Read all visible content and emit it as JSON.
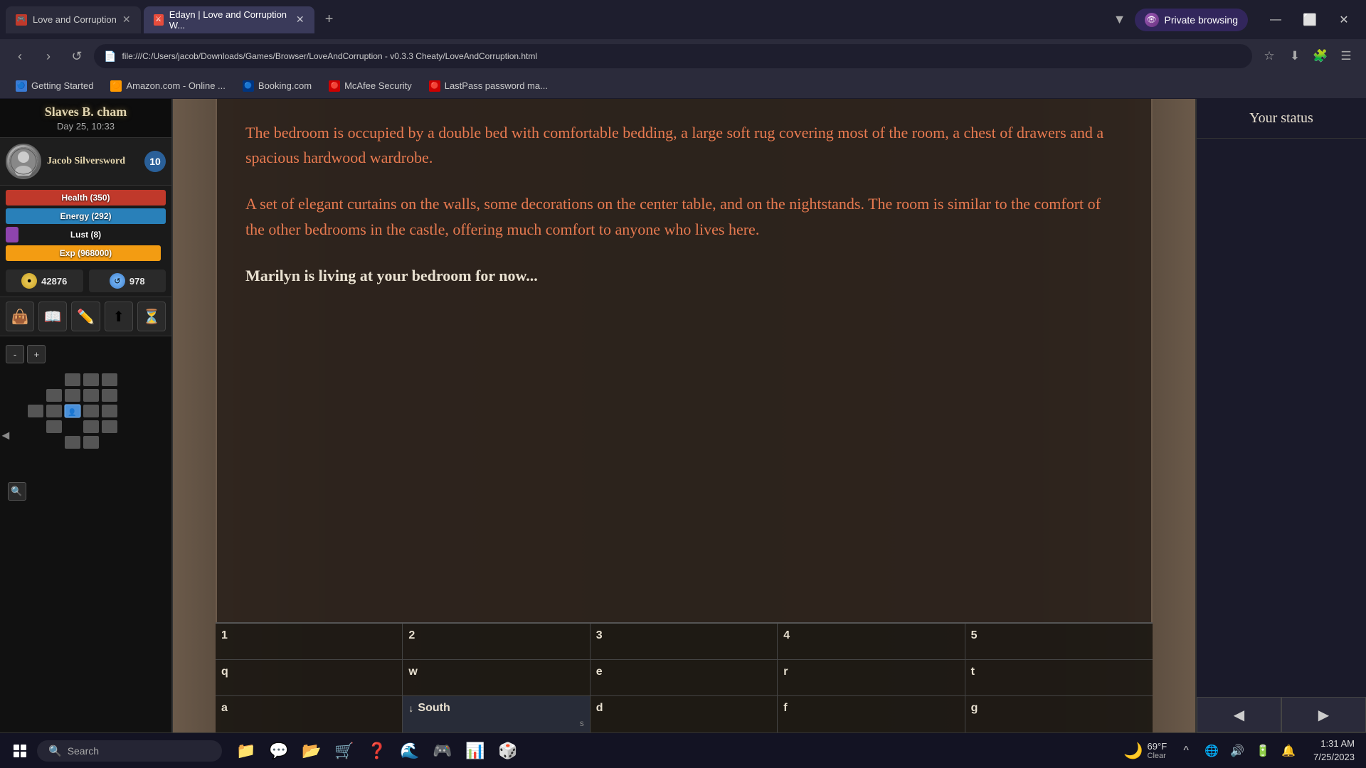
{
  "browser": {
    "tab1": {
      "label": "Love and Corruption",
      "favicon_color": "#c0392b"
    },
    "tab2": {
      "label": "Edayn | Love and Corruption W...",
      "favicon_color": "#e74c3c"
    },
    "address": "file:///C:/Users/jacob/Downloads/Games/Browser/LoveAndCorruption - v0.3.3 Cheaty/LoveAndCorruption.html",
    "bookmarks": [
      {
        "label": "Getting Started",
        "favicon": "🔵"
      },
      {
        "label": "Amazon.com - Online ...",
        "favicon": "🟠"
      },
      {
        "label": "Booking.com",
        "favicon": "🔵"
      },
      {
        "label": "McAfee Security",
        "favicon": "🔴"
      },
      {
        "label": "LastPass password ma...",
        "favicon": "🔴"
      }
    ],
    "private_label": "Private browsing"
  },
  "game": {
    "location": "Slaves B. cham",
    "datetime": "Day 25, 10:33",
    "character": {
      "name": "Jacob Silversword",
      "level": 10,
      "health_label": "Health (350)",
      "health_pct": 100,
      "energy_label": "Energy (292)",
      "energy_pct": 100,
      "lust_label": "Lust (8)",
      "lust_pct": 8,
      "exp_label": "Exp (968000)",
      "exp_pct": 97
    },
    "currency1": "42876",
    "currency2": "978",
    "actions": [
      "👜",
      "📖",
      "✏️",
      "⬆",
      "⏳"
    ],
    "text": {
      "paragraph1": "The bedroom is occupied by a double bed with comfortable bedding, a large soft rug covering most of the room, a chest of drawers and a spacious hardwood wardrobe.",
      "paragraph2": "A set of elegant curtains on the walls, some decorations on the center table, and on the nightstands. The room is similar to the comfort of the other bedrooms in the castle, offering much comfort to anyone who lives here.",
      "paragraph3": "Marilyn is living at your bedroom for now..."
    },
    "choices": {
      "row1": [
        {
          "label": "1",
          "key": "",
          "active": false
        },
        {
          "label": "2",
          "key": "",
          "active": false
        },
        {
          "label": "3",
          "key": "",
          "active": false
        },
        {
          "label": "4",
          "key": "",
          "active": false
        },
        {
          "label": "5",
          "key": "",
          "active": false
        }
      ],
      "row2": [
        {
          "label": "q",
          "key": "",
          "active": false
        },
        {
          "label": "w",
          "key": "",
          "active": false
        },
        {
          "label": "e",
          "key": "",
          "active": false
        },
        {
          "label": "r",
          "key": "",
          "active": false
        },
        {
          "label": "t",
          "key": "",
          "active": false
        }
      ],
      "row3": [
        {
          "label": "a",
          "key": "",
          "active": false
        },
        {
          "label": "↓ South",
          "key": "s",
          "active": true
        },
        {
          "label": "d",
          "key": "",
          "active": false
        },
        {
          "label": "f",
          "key": "",
          "active": false
        },
        {
          "label": "g",
          "key": "",
          "active": false
        }
      ]
    },
    "status_panel_label": "Your status"
  },
  "taskbar": {
    "search_placeholder": "Search",
    "clock_time": "1:31 AM",
    "clock_date": "7/25/2023",
    "weather_temp": "69°F",
    "weather_condition": "Clear",
    "weather_icon": "🌙"
  }
}
